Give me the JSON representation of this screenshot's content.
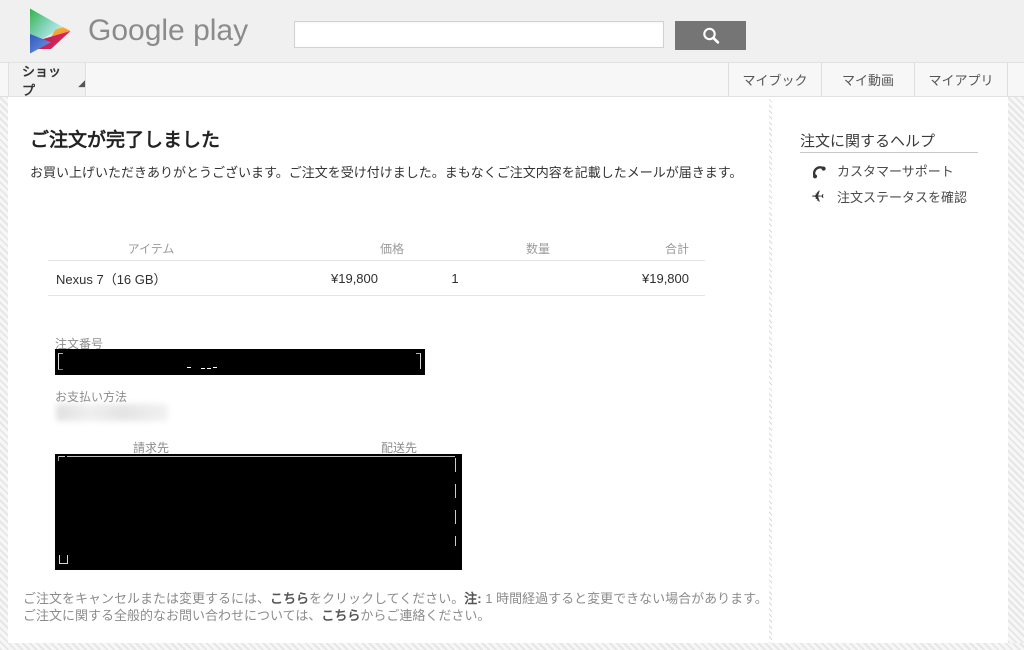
{
  "accent_colors": {
    "header_bg": "#f0f0f0",
    "search_button_bg": "#757575",
    "redaction": "#000000",
    "play_green": "#3bb54a",
    "play_blue": "#4a5bc4",
    "play_red": "#d6275e",
    "play_orange": "#f5a623"
  },
  "header": {
    "brand": "Google play",
    "search": {
      "value": "",
      "placeholder": ""
    }
  },
  "nav": {
    "shop_tab": "ショップ",
    "right_items": [
      {
        "label": "マイブック"
      },
      {
        "label": "マイ動画"
      },
      {
        "label": "マイアプリ"
      }
    ]
  },
  "main": {
    "title": "ご注文が完了しました",
    "intro": "お買い上げいただきありがとうございます。ご注文を受け付けました。まもなくご注文内容を記載したメールが届きます。",
    "order_table": {
      "headers": [
        "アイテム",
        "価格",
        "数量",
        "合計"
      ],
      "rows": [
        {
          "item": "Nexus 7（16 GB）",
          "price": "¥19,800",
          "qty": "1",
          "total": "¥19,800"
        }
      ]
    },
    "order_number_label": "注文番号",
    "payment_method_label": "お支払い方法",
    "billing_label": "請求先",
    "shipping_label": "配送先",
    "footer_line1": [
      {
        "text": "ご注文をキャンセルまたは変更するには、",
        "bold": false,
        "link": false
      },
      {
        "text": "こちら",
        "bold": true,
        "link": true
      },
      {
        "text": "をクリックしてください。",
        "bold": false,
        "link": false
      },
      {
        "text": "注:",
        "bold": true,
        "link": false
      },
      {
        "text": " 1 時間経過すると変更できない場合があります。",
        "bold": false,
        "link": false
      }
    ],
    "footer_line2": [
      {
        "text": "ご注文に関する全般的なお問い合わせについては、",
        "bold": false,
        "link": false
      },
      {
        "text": "こちら",
        "bold": true,
        "link": true
      },
      {
        "text": "からご連絡ください。",
        "bold": false,
        "link": false
      }
    ]
  },
  "sidebar": {
    "heading": "注文に関するヘルプ",
    "items": [
      {
        "icon": "phone-icon",
        "label": "カスタマーサポート"
      },
      {
        "icon": "airplane-icon",
        "label": "注文ステータスを確認"
      }
    ]
  }
}
